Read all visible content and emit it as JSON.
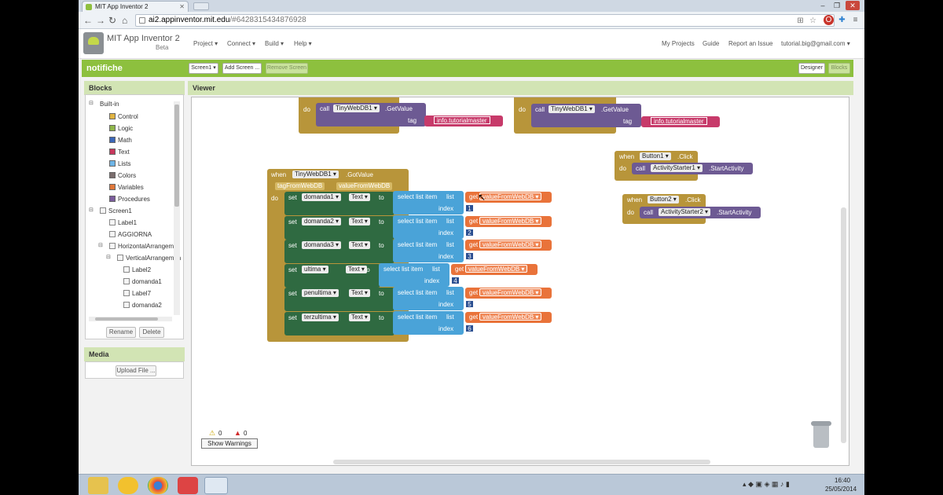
{
  "browser": {
    "tab_title": "MIT App Inventor 2",
    "url_host": "ai2.appinventor.mit.edu",
    "url_path": "/#6428315434876928"
  },
  "app": {
    "title": "MIT App Inventor 2",
    "beta": "Beta",
    "menu": [
      "Project ▾",
      "Connect ▾",
      "Build ▾",
      "Help ▾"
    ],
    "right_menu": [
      "My Projects",
      "Guide",
      "Report an Issue",
      "tutorial.big@gmail.com ▾"
    ]
  },
  "toolbar": {
    "project_name": "notifiche",
    "screen_select": "Screen1 ▾",
    "add_screen": "Add Screen ...",
    "remove_screen": "Remove Screen",
    "designer": "Designer",
    "blocks": "Blocks"
  },
  "blocks_panel": {
    "title": "Blocks",
    "builtin": "Built-in",
    "builtin_items": [
      {
        "label": "Control",
        "color": "#e0b341"
      },
      {
        "label": "Logic",
        "color": "#8fb64a"
      },
      {
        "label": "Math",
        "color": "#3b67b8"
      },
      {
        "label": "Text",
        "color": "#c6365c"
      },
      {
        "label": "Lists",
        "color": "#6db4e6"
      },
      {
        "label": "Colors",
        "color": "#7a6d6d"
      },
      {
        "label": "Variables",
        "color": "#e0773a"
      },
      {
        "label": "Procedures",
        "color": "#7a5c9c"
      }
    ],
    "screen1": "Screen1",
    "components": [
      "Label1",
      "AGGIORNA",
      "HorizontalArrangemer",
      "VerticalArrangemen",
      "Label2",
      "domanda1",
      "Label7",
      "domanda2"
    ],
    "rename": "Rename",
    "delete": "Delete"
  },
  "media_panel": {
    "title": "Media",
    "upload": "Upload File ..."
  },
  "viewer": {
    "title": "Viewer",
    "warnings_count": "0",
    "errors_count": "0",
    "show_warnings": "Show Warnings"
  },
  "workspace": {
    "top_left": {
      "do": "do",
      "call": "call",
      "component": "TinyWebDB1 ▾",
      "method": ".GetValue",
      "tag": "tag",
      "value": "info.tutorialmaster"
    },
    "top_right": {
      "do": "do",
      "call": "call",
      "component": "TinyWebDB1 ▾",
      "method": ".GetValue",
      "tag": "tag",
      "value": "info.tutorialmaster"
    },
    "got_value": {
      "when": "when",
      "component": "TinyWebDB1 ▾",
      "event": ".GotValue",
      "param1": "tagFromWebDB",
      "param2": "valueFromWebDB",
      "do": "do",
      "set": "set",
      "to": "to",
      "select": "select list item",
      "list": "list",
      "index": "index",
      "get": "get",
      "var": "valueFromWebDB ▾",
      "prop": "Text ▾",
      "rows": [
        {
          "target": "domanda1 ▾",
          "idx": "1"
        },
        {
          "target": "domanda2 ▾",
          "idx": "2"
        },
        {
          "target": "domanda3 ▾",
          "idx": "3"
        },
        {
          "target": "ultima ▾",
          "idx": "4"
        },
        {
          "target": "penultima ▾",
          "idx": "5"
        },
        {
          "target": "terzultima ▾",
          "idx": "6"
        }
      ]
    },
    "button1": {
      "when": "when",
      "component": "Button1 ▾",
      "event": ".Click",
      "do": "do",
      "call": "call",
      "target": "ActivityStarter1 ▾",
      "method": ".StartActivity"
    },
    "button2": {
      "when": "when",
      "component": "Button2 ▾",
      "event": ".Click",
      "do": "do",
      "call": "call",
      "target": "ActivityStarter2 ▾",
      "method": ".StartActivity"
    }
  },
  "taskbar": {
    "time": "16:40",
    "date": "25/05/2014"
  }
}
